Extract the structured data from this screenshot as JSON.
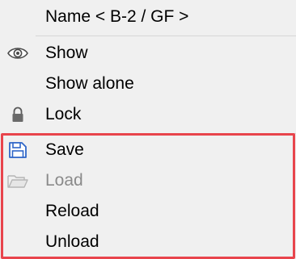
{
  "menu": {
    "title": "Name < B-2 / GF >",
    "items": [
      {
        "label": "Show",
        "icon": "eye-icon",
        "enabled": true
      },
      {
        "label": "Show alone",
        "icon": "",
        "enabled": true
      },
      {
        "label": "Lock",
        "icon": "lock-icon",
        "enabled": true
      },
      {
        "label": "Save",
        "icon": "save-icon",
        "enabled": true
      },
      {
        "label": "Load",
        "icon": "folder-open-icon",
        "enabled": false
      },
      {
        "label": "Reload",
        "icon": "",
        "enabled": true
      },
      {
        "label": "Unload",
        "icon": "",
        "enabled": true
      }
    ]
  },
  "colors": {
    "highlight_border": "#e8444c",
    "save_icon": "#2f66c8",
    "disabled_text": "#8a8a8a",
    "menu_background": "#f0f0f0"
  }
}
